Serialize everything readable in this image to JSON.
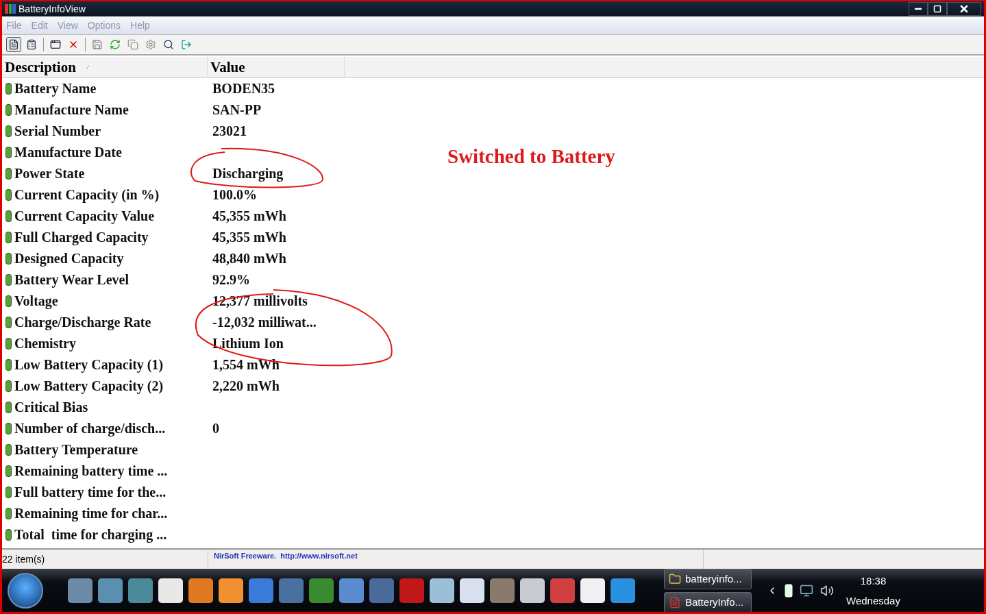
{
  "window": {
    "title": "BatteryInfoView"
  },
  "menu": [
    "File",
    "Edit",
    "View",
    "Options",
    "Help"
  ],
  "toolbar": [
    {
      "pressed": true
    },
    {
      "pressed": false
    },
    {
      "pressed": false
    },
    {
      "pressed": false
    },
    {
      "pressed": false
    },
    {
      "pressed": false
    },
    {
      "pressed": false
    },
    {
      "pressed": false
    },
    {
      "pressed": false
    },
    {
      "pressed": false
    }
  ],
  "table": {
    "columns": [
      "Description",
      "Value"
    ],
    "rows": [
      {
        "description": "Battery Name",
        "value": "BODEN35"
      },
      {
        "description": "Manufacture Name",
        "value": "SAN-PP"
      },
      {
        "description": "Serial Number",
        "value": "23021"
      },
      {
        "description": "Manufacture Date"
      },
      {
        "description": "Power State",
        "value": "Discharging"
      },
      {
        "description": "Current Capacity (in %)",
        "value": "100.0%"
      },
      {
        "description": "Current Capacity Value",
        "value": "45,355 mWh"
      },
      {
        "description": "Full Charged Capacity",
        "value": "45,355 mWh"
      },
      {
        "description": "Designed Capacity",
        "value": "48,840 mWh"
      },
      {
        "description": "Battery Wear Level",
        "value": "92.9%"
      },
      {
        "description": "Voltage",
        "value": "12,377 millivolts"
      },
      {
        "description": "Charge/Discharge Rate",
        "value": "-12,032 milliwat..."
      },
      {
        "description": "Chemistry",
        "value": "Lithium Ion"
      },
      {
        "description": "Low Battery Capacity (1)",
        "value": "1,554 mWh"
      },
      {
        "description": "Low Battery Capacity (2)",
        "value": "2,220 mWh"
      },
      {
        "description": "Critical Bias"
      },
      {
        "description": "Number of charge/disch...",
        "value": "0"
      },
      {
        "description": "Battery Temperature"
      },
      {
        "description": "Remaining battery time ..."
      },
      {
        "description": "Full battery time for the..."
      },
      {
        "description": "Remaining time for char..."
      },
      {
        "description": "Total  time for charging ..."
      }
    ]
  },
  "annotation": {
    "text": "Switched to Battery"
  },
  "status_bar": {
    "count": "22 item(s)",
    "credit": "NirSoft Freeware.  http://www.nirsoft.net"
  },
  "taskbar": {
    "tasks": [
      "batteryinfo...",
      "BatteryInfo..."
    ],
    "time": "18:38",
    "day": "Wednesday"
  }
}
